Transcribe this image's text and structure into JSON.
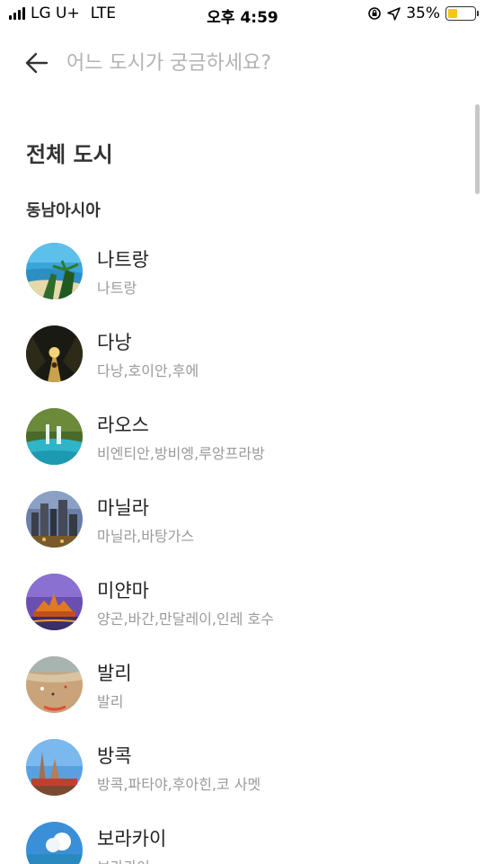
{
  "status_bar": {
    "carrier": "LG U+",
    "network": "LTE",
    "time": "오후 4:59",
    "battery_percent": "35%",
    "battery_level": 0.35,
    "icons": [
      "signal-icon",
      "rotation-lock-icon",
      "location-arrow-icon",
      "battery-icon"
    ]
  },
  "search": {
    "placeholder": "어느 도시가 궁금하세요?",
    "value": ""
  },
  "section_title": "전체 도시",
  "region_title": "동남아시아",
  "cities": [
    {
      "name": "나트랑",
      "sub": "나트랑"
    },
    {
      "name": "다낭",
      "sub": "다낭,호이안,후에"
    },
    {
      "name": "라오스",
      "sub": "비엔티안,방비엥,루앙프라방"
    },
    {
      "name": "마닐라",
      "sub": "마닐라,바탕가스"
    },
    {
      "name": "미얀마",
      "sub": "양곤,바간,만달레이,인레 호수"
    },
    {
      "name": "발리",
      "sub": "발리"
    },
    {
      "name": "방콕",
      "sub": "방콕,파타야,후아힌,코 사멧"
    },
    {
      "name": "보라카이",
      "sub": "보라카이"
    }
  ],
  "colors": {
    "accent_battery": "#f5c518",
    "text_primary": "#222222",
    "text_secondary": "#9a9a9a",
    "placeholder": "#b3b3b3"
  }
}
